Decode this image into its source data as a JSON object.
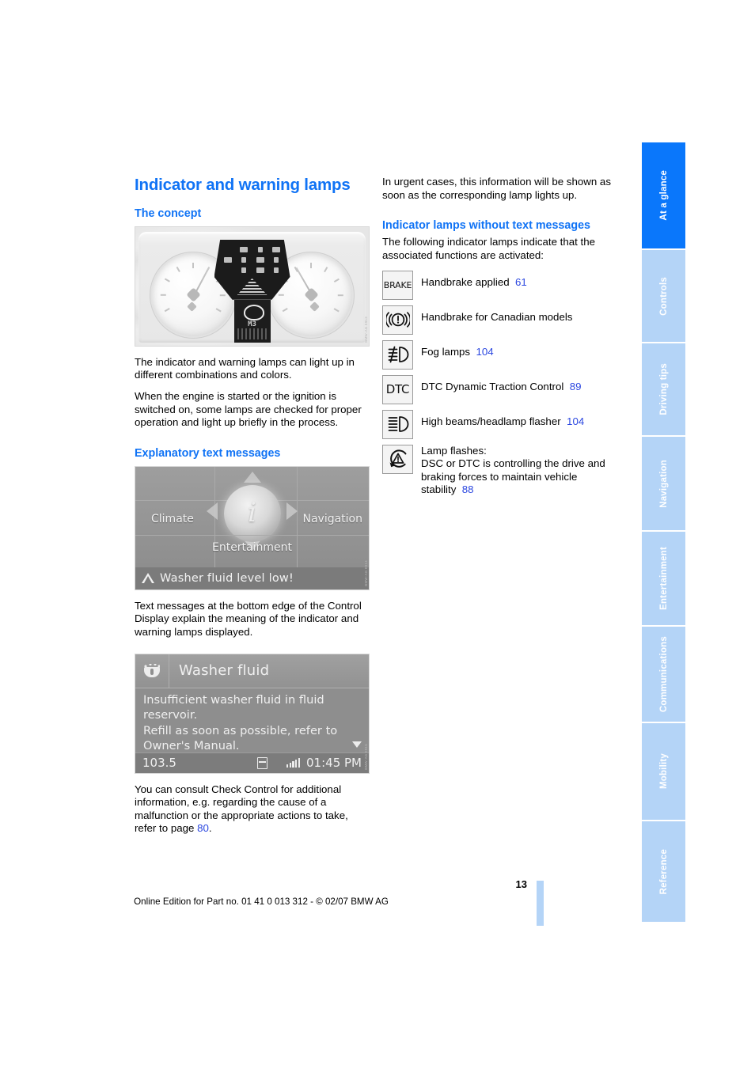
{
  "page": {
    "title": "Indicator and warning lamps",
    "number": "13",
    "footer_note": "Online Edition for Part no. 01 41 0 013 312 - © 02/07 BMW AG"
  },
  "left_column": {
    "concept_heading": "The concept",
    "concept_paragraphs": [
      "The indicator and warning lamps can light up in different combinations and colors.",
      "When the engine is started or the ignition is switched on, some lamps are checked for proper operation and light up briefly in the process."
    ],
    "explanatory_heading": "Explanatory text messages",
    "explanatory_paragraph": "Text messages at the bottom edge of the Control Display explain the meaning of the indicator and warning lamps displayed.",
    "check_control_paragraph_pre": "You can consult Check Control for additional information, e.g. regarding the cause of a malfunction or the appropriate actions to take, refer to page ",
    "check_control_page_ref": "80",
    "check_control_paragraph_post": "."
  },
  "figures": {
    "cluster": {
      "gear_indicator": "M3"
    },
    "idrive_menu": {
      "climate": "Climate",
      "navigation": "Navigation",
      "entertainment": "Entertainment",
      "center_icon": "i",
      "status_message": "Washer fluid level low!"
    },
    "washer_message": {
      "title": "Washer fluid",
      "body": "Insufficient washer fluid in fluid reservoir.\nRefill as soon as possible, refer to Owner's Manual.",
      "radio_frequency": "103.5",
      "time": "01:45 PM"
    }
  },
  "right_column": {
    "intro_paragraph": "In urgent cases, this information will be shown as soon as the corresponding lamp lights up.",
    "lamps_heading": "Indicator lamps without text messages",
    "lamps_intro": "The following indicator lamps indicate that the associated functions are activated:",
    "lamps": [
      {
        "icon": "brake-word-lamp-icon",
        "icon_text": "BRAKE",
        "label": "Handbrake applied",
        "page_ref": "61"
      },
      {
        "icon": "handbrake-canadian-lamp-icon",
        "icon_text": "",
        "label": "Handbrake for Canadian models",
        "page_ref": ""
      },
      {
        "icon": "fog-lamp-icon",
        "icon_text": "",
        "label": "Fog lamps",
        "page_ref": "104"
      },
      {
        "icon": "dtc-word-lamp-icon",
        "icon_text": "DTC",
        "label": "DTC Dynamic Traction Control",
        "page_ref": "89"
      },
      {
        "icon": "high-beam-lamp-icon",
        "icon_text": "",
        "label": "High beams/headlamp flasher",
        "page_ref": "104"
      },
      {
        "icon": "dsc-flashing-lamp-icon",
        "icon_text": "",
        "label": "Lamp flashes:\nDSC or DTC is controlling the drive and braking forces to maintain vehicle stability",
        "page_ref": "88"
      }
    ]
  },
  "sidebar": {
    "tabs": [
      {
        "label": "At a glance",
        "active": true
      },
      {
        "label": "Controls",
        "active": false
      },
      {
        "label": "Driving tips",
        "active": false
      },
      {
        "label": "Navigation",
        "active": false
      },
      {
        "label": "Entertainment",
        "active": false
      },
      {
        "label": "Communications",
        "active": false
      },
      {
        "label": "Mobility",
        "active": false
      },
      {
        "label": "Reference",
        "active": false
      }
    ]
  },
  "colors": {
    "heading_blue": "#1073f5",
    "page_ref_blue": "#2b47e0",
    "tab_active": "#0a77fb",
    "tab_inactive": "#b4d4f7"
  }
}
